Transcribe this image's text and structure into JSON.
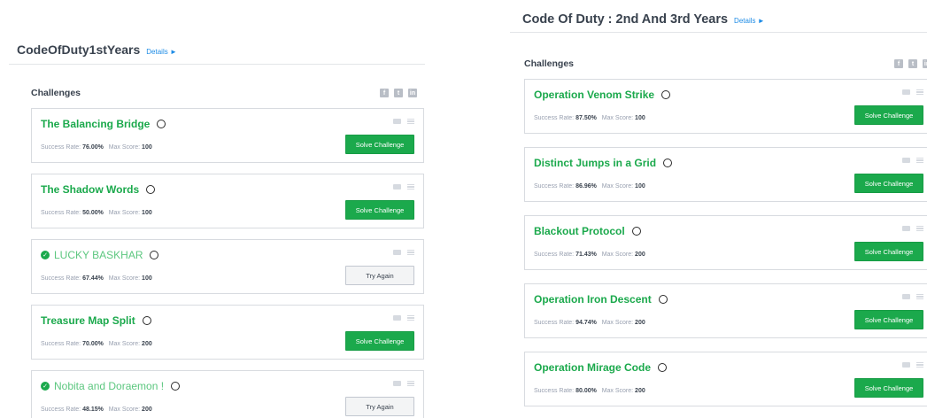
{
  "left": {
    "title": "CodeOfDuty1stYears",
    "details": "Details ►",
    "section": "Challenges",
    "challenges": [
      {
        "title": "The Balancing Bridge",
        "solved": false,
        "success_label": "Success Rate:",
        "success": "76.00%",
        "score_label": "Max Score:",
        "score": "100",
        "action": "Solve Challenge"
      },
      {
        "title": "The Shadow Words",
        "solved": false,
        "success_label": "Success Rate:",
        "success": "50.00%",
        "score_label": "Max Score:",
        "score": "100",
        "action": "Solve Challenge"
      },
      {
        "title": "LUCKY BASKHAR",
        "solved": true,
        "success_label": "Success Rate:",
        "success": "67.44%",
        "score_label": "Max Score:",
        "score": "100",
        "action": "Try Again"
      },
      {
        "title": "Treasure Map Split",
        "solved": false,
        "success_label": "Success Rate:",
        "success": "70.00%",
        "score_label": "Max Score:",
        "score": "200",
        "action": "Solve Challenge"
      },
      {
        "title": "Nobita and Doraemon !",
        "solved": true,
        "success_label": "Success Rate:",
        "success": "48.15%",
        "score_label": "Max Score:",
        "score": "200",
        "action": "Try Again"
      }
    ]
  },
  "right": {
    "title": "Code Of Duty : 2nd And 3rd Years",
    "details": "Details ►",
    "section": "Challenges",
    "challenges": [
      {
        "title": "Operation Venom Strike",
        "solved": false,
        "success_label": "Success Rate:",
        "success": "87.50%",
        "score_label": "Max Score:",
        "score": "100",
        "action": "Solve Challenge"
      },
      {
        "title": "Distinct Jumps in a Grid",
        "solved": false,
        "success_label": "Success Rate:",
        "success": "86.96%",
        "score_label": "Max Score:",
        "score": "100",
        "action": "Solve Challenge"
      },
      {
        "title": "Blackout Protocol",
        "solved": false,
        "success_label": "Success Rate:",
        "success": "71.43%",
        "score_label": "Max Score:",
        "score": "200",
        "action": "Solve Challenge"
      },
      {
        "title": "Operation Iron Descent",
        "solved": false,
        "success_label": "Success Rate:",
        "success": "94.74%",
        "score_label": "Max Score:",
        "score": "200",
        "action": "Solve Challenge"
      },
      {
        "title": "Operation Mirage Code",
        "solved": false,
        "success_label": "Success Rate:",
        "success": "80.00%",
        "score_label": "Max Score:",
        "score": "200",
        "action": "Solve Challenge"
      }
    ]
  },
  "social_icons": [
    "facebook-icon",
    "twitter-icon",
    "linkedin-icon"
  ]
}
